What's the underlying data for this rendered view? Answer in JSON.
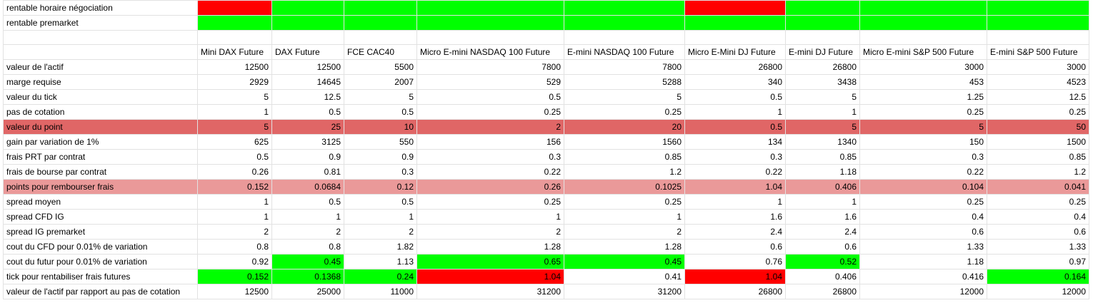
{
  "sheet": {
    "indicators": [
      {
        "label": "rentable horaire négociation",
        "cells": [
          "#ff0000",
          "#00ff00",
          "#00ff00",
          "#00ff00",
          "#00ff00",
          "#ff0000",
          "#00ff00",
          "#00ff00",
          "#00ff00"
        ]
      },
      {
        "label": "rentable premarket",
        "cells": [
          "#00ff00",
          "#00ff00",
          "#00ff00",
          "#00ff00",
          "#00ff00",
          "#00ff00",
          "#00ff00",
          "#00ff00",
          "#00ff00"
        ]
      }
    ],
    "headers": [
      "Mini DAX Future",
      "DAX Future",
      "FCE CAC40",
      "Micro E-mini NASDAQ 100 Future",
      "E-mini NASDAQ 100 Future",
      "Micro E-Mini DJ Future",
      "E-mini DJ Future",
      "Micro E-mini S&P 500 Future",
      "E-mini S&P 500 Future"
    ],
    "rows": [
      {
        "label": "valeur de l'actif",
        "values": [
          "12500",
          "12500",
          "5500",
          "7800",
          "7800",
          "26800",
          "26800",
          "3000",
          "3000"
        ]
      },
      {
        "label": "marge requise",
        "values": [
          "2929",
          "14645",
          "2007",
          "529",
          "5288",
          "340",
          "3438",
          "453",
          "4523"
        ]
      },
      {
        "label": "valeur du tick",
        "values": [
          "5",
          "12.5",
          "5",
          "0.5",
          "5",
          "0.5",
          "5",
          "1.25",
          "12.5"
        ]
      },
      {
        "label": "pas de cotation",
        "values": [
          "1",
          "0.5",
          "0.5",
          "0.25",
          "0.25",
          "1",
          "1",
          "0.25",
          "0.25"
        ]
      },
      {
        "label": "valeur du point",
        "values": [
          "5",
          "25",
          "10",
          "2",
          "20",
          "0.5",
          "5",
          "5",
          "50"
        ],
        "row_color": "#e06666"
      },
      {
        "label": "gain par variation de 1%",
        "values": [
          "625",
          "3125",
          "550",
          "156",
          "1560",
          "134",
          "1340",
          "150",
          "1500"
        ]
      },
      {
        "label": "frais PRT par contrat",
        "values": [
          "0.5",
          "0.9",
          "0.9",
          "0.3",
          "0.85",
          "0.3",
          "0.85",
          "0.3",
          "0.85"
        ]
      },
      {
        "label": "frais de bourse par contrat",
        "values": [
          "0.26",
          "0.81",
          "0.3",
          "0.22",
          "1.2",
          "0.22",
          "1.18",
          "0.22",
          "1.2"
        ]
      },
      {
        "label": "points pour rembourser frais",
        "values": [
          "0.152",
          "0.0684",
          "0.12",
          "0.26",
          "0.1025",
          "1.04",
          "0.406",
          "0.104",
          "0.041"
        ],
        "row_color": "#ea9999"
      },
      {
        "label": "spread moyen",
        "values": [
          "1",
          "0.5",
          "0.5",
          "0.25",
          "0.25",
          "1",
          "1",
          "0.25",
          "0.25"
        ]
      },
      {
        "label": "spread CFD IG",
        "values": [
          "1",
          "1",
          "1",
          "1",
          "1",
          "1.6",
          "1.6",
          "0.4",
          "0.4"
        ]
      },
      {
        "label": "spread IG premarket",
        "values": [
          "2",
          "2",
          "2",
          "2",
          "2",
          "2.4",
          "2.4",
          "0.6",
          "0.6"
        ]
      },
      {
        "label": "cout du CFD pour 0.01% de variation",
        "values": [
          "0.8",
          "0.8",
          "1.82",
          "1.28",
          "1.28",
          "0.6",
          "0.6",
          "1.33",
          "1.33"
        ]
      },
      {
        "label": "cout du futur pour 0.01% de variation",
        "values": [
          "0.92",
          "0.45",
          "1.13",
          "0.65",
          "0.45",
          "0.76",
          "0.52",
          "1.18",
          "0.97"
        ],
        "cell_colors": [
          "",
          "#00ff00",
          "",
          "#00ff00",
          "#00ff00",
          "",
          "#00ff00",
          "",
          ""
        ]
      },
      {
        "label": "tick pour rentabiliser frais futures",
        "values": [
          "0.152",
          "0.1368",
          "0.24",
          "1.04",
          "0.41",
          "1.04",
          "0.406",
          "0.416",
          "0.164"
        ],
        "label_color": "#00ff00",
        "cell_colors": [
          "#00ff00",
          "#00ff00",
          "#00ff00",
          "#ff0000",
          "",
          "#ff0000",
          "",
          "",
          "#00ff00"
        ]
      },
      {
        "label": "valeur de l'actif par rapport au pas de cotation",
        "values": [
          "12500",
          "25000",
          "11000",
          "31200",
          "31200",
          "26800",
          "26800",
          "12000",
          "12000"
        ]
      }
    ]
  }
}
